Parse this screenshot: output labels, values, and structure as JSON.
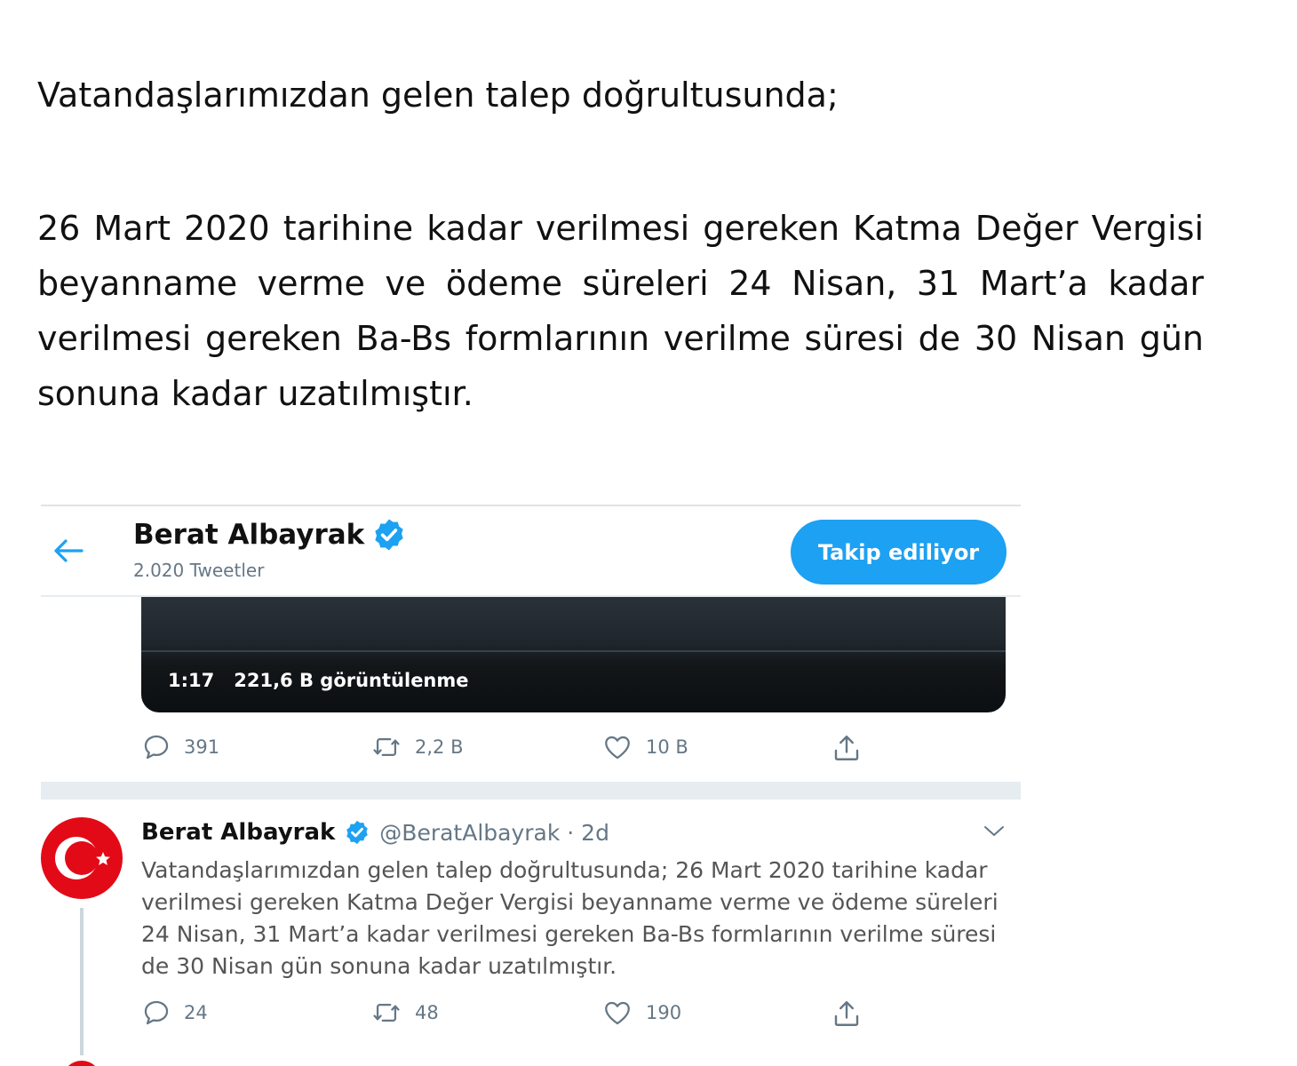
{
  "article": {
    "paragraph1": "Vatandaşlarımızdan gelen talep doğrultusunda;",
    "paragraph2": "26 Mart 2020 tarihine kadar verilmesi gereken Katma Değer Vergisi beyanname verme ve ödeme süreleri 24 Nisan, 31 Mart’a kadar verilmesi gereken Ba-Bs formlarının verilme süresi de 30 Nisan gün sonuna kadar uzatılmıştır."
  },
  "profile_header": {
    "back_icon": "arrow-left-icon",
    "name": "Berat Albayrak",
    "verified_icon": "verified-badge-icon",
    "tweet_count": "2.020 Tweetler",
    "follow_button": "Takip ediliyor"
  },
  "video_tweet": {
    "duration": "1:17",
    "views": "221,6 B görüntülenme",
    "actions": {
      "reply_count": "391",
      "retweet_count": "2,2 B",
      "like_count": "10 B"
    }
  },
  "tweet": {
    "name": "Berat Albayrak",
    "handle_time": "@BeratAlbayrak · 2d",
    "text": "Vatandaşlarımızdan gelen talep doğrultusunda; 26 Mart 2020 tarihine kadar verilmesi gereken Katma Değer Vergisi beyanname verme ve ödeme süreleri 24 Nisan, 31 Mart’a kadar  verilmesi gereken Ba-Bs formlarının verilme süresi de 30 Nisan gün sonuna kadar uzatılmıştır.",
    "actions": {
      "reply_count": "24",
      "retweet_count": "48",
      "like_count": "190"
    }
  },
  "colors": {
    "twitter_blue": "#1da1f2",
    "secondary_text": "#657786",
    "avatar_red": "#e30a17"
  }
}
